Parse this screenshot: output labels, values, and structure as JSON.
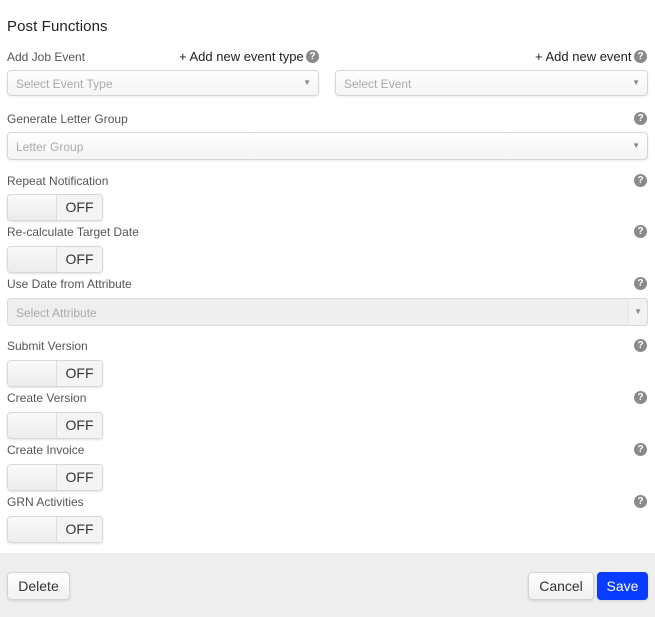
{
  "header": {
    "title": "Post Functions"
  },
  "job_event": {
    "label": "Add Job Event",
    "add_event_type_link": "+ Add new event type",
    "add_event_link": "+ Add new event",
    "event_type_select": {
      "placeholder": "Select Event Type",
      "value": ""
    },
    "event_select": {
      "placeholder": "Select Event",
      "value": ""
    }
  },
  "letter_group": {
    "label": "Generate Letter Group",
    "select": {
      "placeholder": "Letter Group",
      "value": ""
    }
  },
  "repeat_notification": {
    "label": "Repeat Notification",
    "state": "OFF"
  },
  "recalculate_target_date": {
    "label": "Re-calculate Target Date",
    "state": "OFF"
  },
  "date_from_attribute": {
    "label": "Use Date from Attribute",
    "select": {
      "placeholder": "Select Attribute",
      "value": "",
      "disabled": true
    }
  },
  "submit_version": {
    "label": "Submit Version",
    "state": "OFF"
  },
  "create_version": {
    "label": "Create Version",
    "state": "OFF"
  },
  "create_invoice": {
    "label": "Create Invoice",
    "state": "OFF"
  },
  "grn_activities": {
    "label": "GRN Activities",
    "state": "OFF"
  },
  "icons": {
    "help": "?",
    "caret": "▼"
  },
  "footer": {
    "delete_label": "Delete",
    "cancel_label": "Cancel",
    "save_label": "Save"
  },
  "colors": {
    "primary": "#0a3cff",
    "footer_bg": "#eeeeee"
  }
}
